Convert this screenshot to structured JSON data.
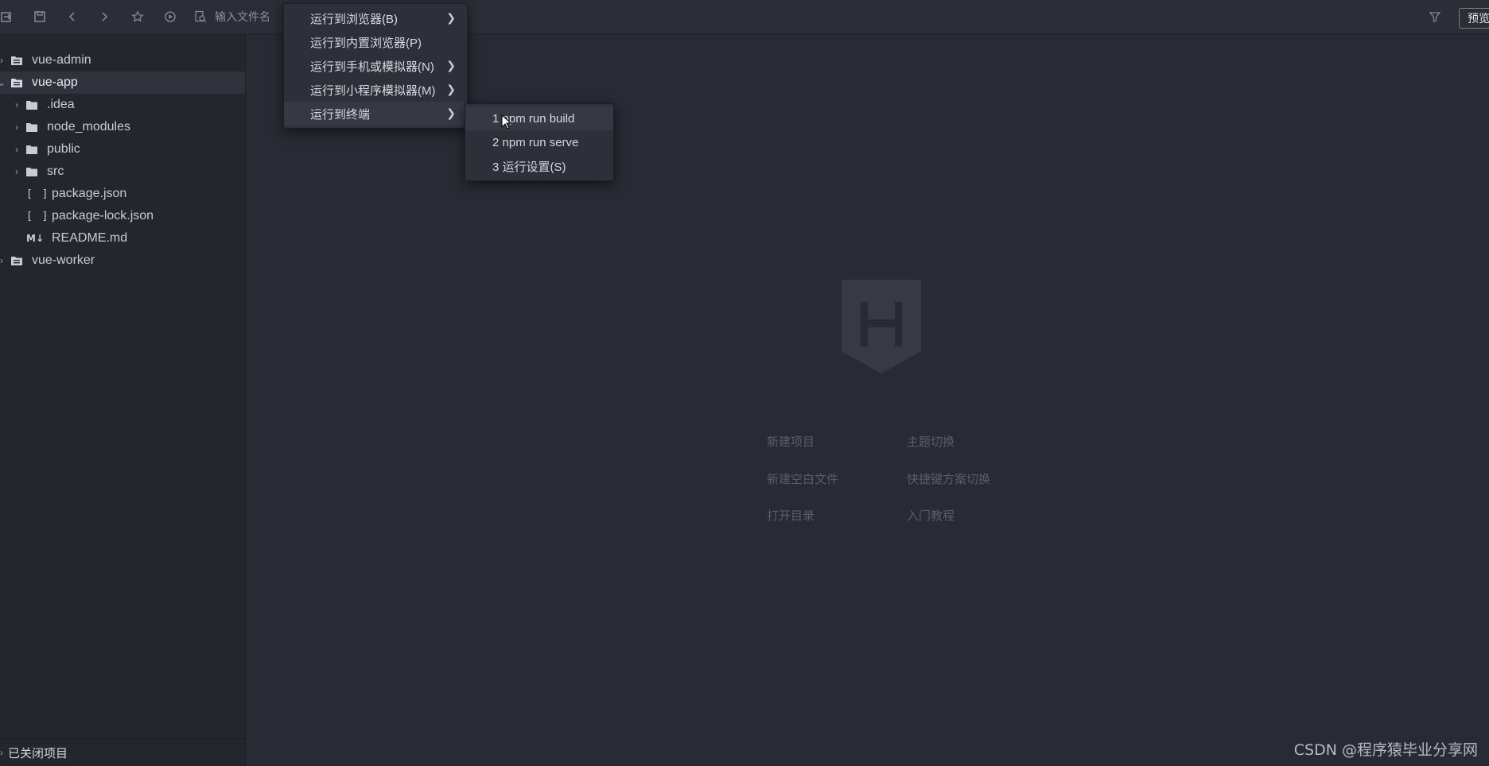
{
  "toolbar": {
    "search_placeholder": "输入文件名",
    "preview_label": "预览",
    "icons": [
      "import-icon",
      "save-icon",
      "back-icon",
      "forward-icon",
      "star-icon",
      "run-icon",
      "file-search-icon",
      "filter-icon"
    ]
  },
  "sidebar": {
    "items": [
      {
        "label": "vue-admin",
        "kind": "project",
        "expanded": false,
        "depth": 0
      },
      {
        "label": "vue-app",
        "kind": "project",
        "expanded": true,
        "depth": 0,
        "selected": true
      },
      {
        "label": ".idea",
        "kind": "folder",
        "depth": 1
      },
      {
        "label": "node_modules",
        "kind": "folder",
        "depth": 1
      },
      {
        "label": "public",
        "kind": "folder",
        "depth": 1
      },
      {
        "label": "src",
        "kind": "folder",
        "depth": 1
      },
      {
        "label": "package.json",
        "kind": "json",
        "depth": 1
      },
      {
        "label": "package-lock.json",
        "kind": "json",
        "depth": 1
      },
      {
        "label": "README.md",
        "kind": "markdown",
        "depth": 1
      },
      {
        "label": "vue-worker",
        "kind": "project",
        "expanded": false,
        "depth": 0
      }
    ],
    "footer_label": "已关闭项目"
  },
  "welcome": {
    "links": [
      "新建项目",
      "主题切换",
      "新建空白文件",
      "快捷键方案切换",
      "打开目录",
      "入门教程"
    ]
  },
  "run_menu": {
    "items": [
      {
        "label": "运行到浏览器(B)",
        "has_submenu": true
      },
      {
        "label": "运行到内置浏览器(P)",
        "has_submenu": false
      },
      {
        "label": "运行到手机或模拟器(N)",
        "has_submenu": true
      },
      {
        "label": "运行到小程序模拟器(M)",
        "has_submenu": true
      },
      {
        "label": "运行到终端",
        "has_submenu": true,
        "active": true
      }
    ]
  },
  "terminal_submenu": {
    "items": [
      "1 npm run build",
      "2 npm run serve",
      "3 运行设置(S)"
    ]
  },
  "watermark": "CSDN @程序猿毕业分享网",
  "colors": {
    "editor_bg": "#282a34",
    "sidebar_bg": "#24262e",
    "menu_bg": "#2d3039"
  }
}
